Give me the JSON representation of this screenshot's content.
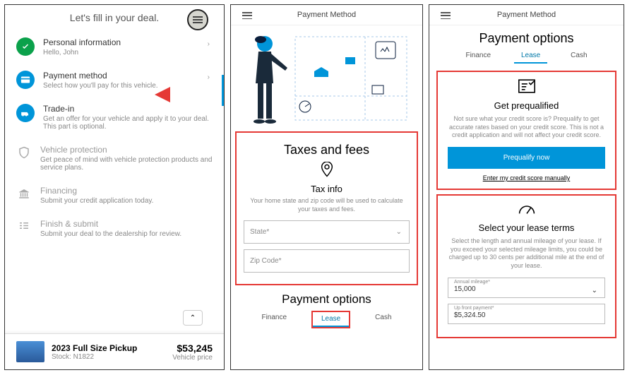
{
  "panel1": {
    "headerTitle": "Let's fill in your deal.",
    "items": [
      {
        "title": "Personal information",
        "sub": "Hello, John"
      },
      {
        "title": "Payment method",
        "sub": "Select how you'll pay for this vehicle."
      },
      {
        "title": "Trade-in",
        "sub": "Get an offer for your vehicle and apply it to your deal. This part is optional."
      },
      {
        "title": "Vehicle protection",
        "sub": "Get peace of mind with vehicle protection products and service plans."
      },
      {
        "title": "Financing",
        "sub": "Submit your credit application today."
      },
      {
        "title": "Finish & submit",
        "sub": "Submit your deal to the dealership for review."
      }
    ],
    "vehicle": {
      "name": "2023 Full Size Pickup",
      "stock": "Stock: N1822",
      "price": "$53,245",
      "priceLabel": "Vehicle price"
    }
  },
  "panel2": {
    "title": "Payment Method",
    "taxesHeading": "Taxes and fees",
    "taxInfo": "Tax info",
    "taxDesc": "Your home state and zip code will be used to calculate your taxes and fees.",
    "statePh": "State*",
    "zipPh": "Zip Code*",
    "payOptions": "Payment options",
    "tabs": {
      "f": "Finance",
      "l": "Lease",
      "c": "Cash"
    }
  },
  "panel3": {
    "title": "Payment Method",
    "optionsTitle": "Payment options",
    "tabs": {
      "f": "Finance",
      "l": "Lease",
      "c": "Cash"
    },
    "prequal": {
      "title": "Get prequalified",
      "desc": "Not sure what your credit score is? Prequalify to get accurate rates based on your credit score. This is not a credit application and will not affect your credit score.",
      "btn": "Prequalify now",
      "link": "Enter my credit score manually"
    },
    "lease": {
      "title": "Select your lease terms",
      "desc": "Select the length and annual mileage of your lease. If you exceed your selected mileage limits, you could be charged up to 30 cents per additional mile at the end of your lease.",
      "mileageLabel": "Annual mileage*",
      "mileageVal": "15,000",
      "upfrontLabel": "Up front payment*",
      "upfrontVal": "$5,324.50"
    }
  }
}
